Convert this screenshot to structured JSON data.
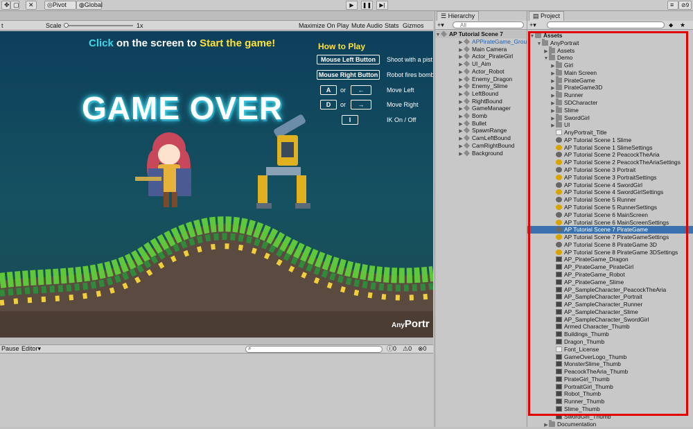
{
  "toolbar": {
    "pivot": "Pivot",
    "global": "Global",
    "collab_count": "9"
  },
  "game_view": {
    "scale_label": "Scale",
    "scale_value": "1x",
    "maximize": "Maximize On Play",
    "mute": "Mute Audio",
    "stats": "Stats",
    "gizmos": "Gizmos",
    "headline_click": "Click",
    "headline_mid": " on the screen to ",
    "headline_start": "Start the game!",
    "game_over": "GAME OVER",
    "how_to_play": "How to Play",
    "controls": [
      {
        "key": "Mouse Left Button",
        "desc": "Shoot with a pist"
      },
      {
        "key": "Mouse Right Button",
        "desc": "Robot fires bomb"
      },
      {
        "key": "A",
        "or": "or",
        "alt": "←",
        "desc": "Move Left"
      },
      {
        "key": "D",
        "or": "or",
        "alt": "→",
        "desc": "Move Right"
      },
      {
        "key": "I",
        "desc": "IK On / Off"
      }
    ],
    "logo_any": "Any",
    "logo_portrait": "Portr",
    "colors": {
      "cyan": "#3ed6e8",
      "yellow": "#ffe33a",
      "grass": "#5ec83a",
      "ground": "#5a4a3f"
    }
  },
  "console": {
    "pause": "Pause",
    "editor": "Editor",
    "count1": "0",
    "count2": "0",
    "count3": "0"
  },
  "hierarchy": {
    "tab": "Hierarchy",
    "search_placeholder": "All",
    "scene": "AP Tutorial Scene 7",
    "items": [
      "APPirateGame_Groun",
      "Main Camera",
      "Actor_PirateGirl",
      "UI_Aim",
      "Actor_Robot",
      "Enemy_Dragon",
      "Enemy_Slime",
      "LeftBound",
      "RightBound",
      "GameManager",
      "Bomb",
      "Bullet",
      "SpawnRange",
      "CamLeftBound",
      "CamRightBound",
      "Background"
    ]
  },
  "project": {
    "tab": "Project",
    "root": "Assets",
    "anyportrait": "AnyPortrait",
    "assets_folder": "Assets",
    "demo": "Demo",
    "demo_folders": [
      "Girl",
      "Main Screen",
      "PirateGame",
      "PirateGame3D",
      "Runner",
      "SDCharacter",
      "Slime",
      "SwordGirl",
      "UI"
    ],
    "files": [
      {
        "name": "AnyPortrait_Title",
        "icon": "white"
      },
      {
        "name": "AP Tutorial Scene 1 Slime",
        "icon": "scene"
      },
      {
        "name": "AP Tutorial Scene 1 SlimeSettings",
        "icon": "asset"
      },
      {
        "name": "AP Tutorial Scene 2 PeacockTheAria",
        "icon": "scene"
      },
      {
        "name": "AP Tutorial Scene 2 PeacockTheAriaSettings",
        "icon": "asset"
      },
      {
        "name": "AP Tutorial Scene 3 Portrait",
        "icon": "scene"
      },
      {
        "name": "AP Tutorial Scene 3 PortraitSettings",
        "icon": "asset"
      },
      {
        "name": "AP Tutorial Scene 4 SwordGirl",
        "icon": "scene"
      },
      {
        "name": "AP Tutorial Scene 4 SwordGirlSettings",
        "icon": "asset"
      },
      {
        "name": "AP Tutorial Scene 5 Runner",
        "icon": "scene"
      },
      {
        "name": "AP Tutorial Scene 5 RunnerSettings",
        "icon": "asset"
      },
      {
        "name": "AP Tutorial Scene 6 MainScreen",
        "icon": "scene"
      },
      {
        "name": "AP Tutorial Scene 6 MainScreenSettings",
        "icon": "asset"
      },
      {
        "name": "AP Tutorial Scene 7 PirateGame",
        "icon": "scene"
      },
      {
        "name": "AP Tutorial Scene 7 PirateGameSettings",
        "icon": "asset"
      },
      {
        "name": "AP Tutorial Scene 8 PirateGame 3D",
        "icon": "scene"
      },
      {
        "name": "AP Tutorial Scene 8 PirateGame 3DSettings",
        "icon": "asset"
      },
      {
        "name": "AP_PirateGame_Dragon",
        "icon": "thumb"
      },
      {
        "name": "AP_PirateGame_PirateGirl",
        "icon": "thumb"
      },
      {
        "name": "AP_PirateGame_Robot",
        "icon": "thumb"
      },
      {
        "name": "AP_PirateGame_Slime",
        "icon": "thumb"
      },
      {
        "name": "AP_SampleCharacter_PeacockTheAria",
        "icon": "thumb"
      },
      {
        "name": "AP_SampleCharacter_Portrait",
        "icon": "thumb"
      },
      {
        "name": "AP_SampleCharacter_Runner",
        "icon": "thumb"
      },
      {
        "name": "AP_SampleCharacter_Slime",
        "icon": "thumb"
      },
      {
        "name": "AP_SampleCharacter_SwordGirl",
        "icon": "thumb"
      },
      {
        "name": "Armed Character_Thumb",
        "icon": "thumb"
      },
      {
        "name": "Buildings_Thumb",
        "icon": "thumb"
      },
      {
        "name": "Dragon_Thumb",
        "icon": "thumb"
      },
      {
        "name": "Font_License",
        "icon": "white"
      },
      {
        "name": "GameOverLogo_Thumb",
        "icon": "thumb"
      },
      {
        "name": "MonsterSlime_Thumb",
        "icon": "thumb"
      },
      {
        "name": "PeacockTheAria_Thumb",
        "icon": "thumb"
      },
      {
        "name": "PirateGirl_Thumb",
        "icon": "thumb"
      },
      {
        "name": "PortraitGirl_Thumb",
        "icon": "thumb"
      },
      {
        "name": "Robot_Thumb",
        "icon": "thumb"
      },
      {
        "name": "Runner_Thumb",
        "icon": "thumb"
      },
      {
        "name": "Slime_Thumb",
        "icon": "thumb"
      },
      {
        "name": "SwordGirl_Thumb",
        "icon": "thumb"
      }
    ],
    "selected_file": "AP Tutorial Scene 7 PirateGame",
    "documentation": "Documentation",
    "highlight_color": "#e00000",
    "selection_color": "#3a72b0"
  }
}
